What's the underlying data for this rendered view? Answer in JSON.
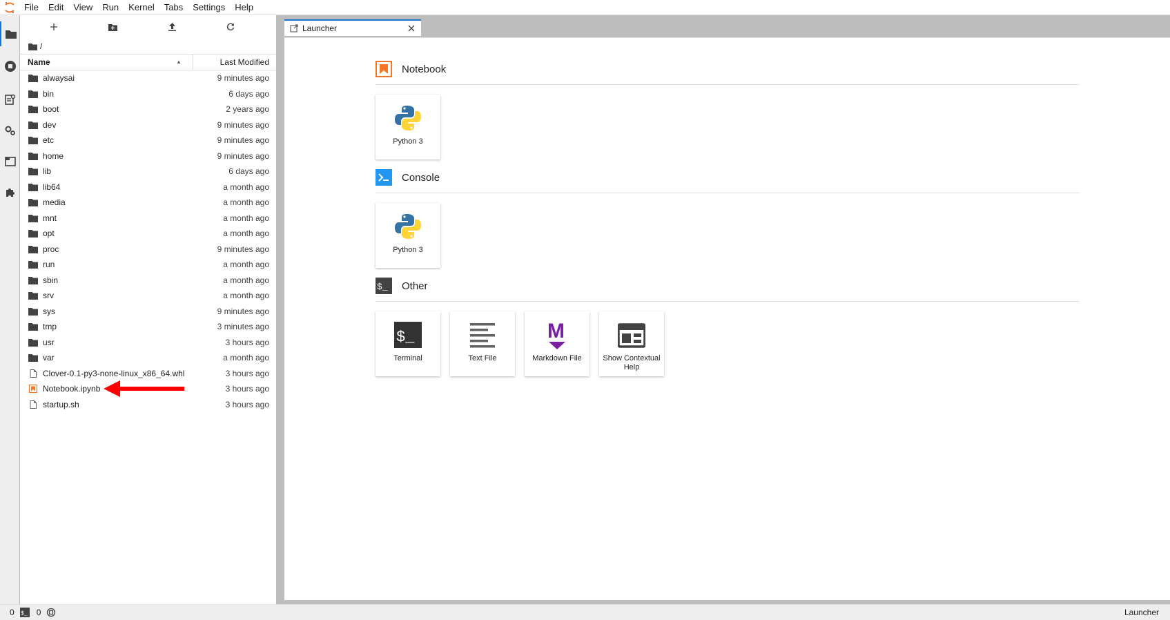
{
  "menubar": {
    "items": [
      "File",
      "Edit",
      "View",
      "Run",
      "Kernel",
      "Tabs",
      "Settings",
      "Help"
    ]
  },
  "activitybar": {
    "icons": [
      "folder-icon",
      "running-icon",
      "commands-icon",
      "property-inspector-icon",
      "tabs-icon",
      "extensions-icon"
    ]
  },
  "filebrowser": {
    "path": "/",
    "header": {
      "name": "Name",
      "modified": "Last Modified"
    },
    "files": [
      {
        "name": "alwaysai",
        "modified": "9 minutes ago",
        "type": "folder"
      },
      {
        "name": "bin",
        "modified": "6 days ago",
        "type": "folder"
      },
      {
        "name": "boot",
        "modified": "2 years ago",
        "type": "folder"
      },
      {
        "name": "dev",
        "modified": "9 minutes ago",
        "type": "folder"
      },
      {
        "name": "etc",
        "modified": "9 minutes ago",
        "type": "folder"
      },
      {
        "name": "home",
        "modified": "9 minutes ago",
        "type": "folder"
      },
      {
        "name": "lib",
        "modified": "6 days ago",
        "type": "folder"
      },
      {
        "name": "lib64",
        "modified": "a month ago",
        "type": "folder"
      },
      {
        "name": "media",
        "modified": "a month ago",
        "type": "folder"
      },
      {
        "name": "mnt",
        "modified": "a month ago",
        "type": "folder"
      },
      {
        "name": "opt",
        "modified": "a month ago",
        "type": "folder"
      },
      {
        "name": "proc",
        "modified": "9 minutes ago",
        "type": "folder"
      },
      {
        "name": "run",
        "modified": "a month ago",
        "type": "folder"
      },
      {
        "name": "sbin",
        "modified": "a month ago",
        "type": "folder"
      },
      {
        "name": "srv",
        "modified": "a month ago",
        "type": "folder"
      },
      {
        "name": "sys",
        "modified": "9 minutes ago",
        "type": "folder"
      },
      {
        "name": "tmp",
        "modified": "3 minutes ago",
        "type": "folder"
      },
      {
        "name": "usr",
        "modified": "3 hours ago",
        "type": "folder"
      },
      {
        "name": "var",
        "modified": "a month ago",
        "type": "folder"
      },
      {
        "name": "Clover-0.1-py3-none-linux_x86_64.whl",
        "modified": "3 hours ago",
        "type": "file"
      },
      {
        "name": "Notebook.ipynb",
        "modified": "3 hours ago",
        "type": "notebook"
      },
      {
        "name": "startup.sh",
        "modified": "3 hours ago",
        "type": "file"
      }
    ]
  },
  "tabs": [
    {
      "label": "Launcher"
    }
  ],
  "launcher": {
    "sections": [
      {
        "title": "Notebook",
        "cards": [
          {
            "label": "Python 3",
            "icon": "python-icon"
          }
        ]
      },
      {
        "title": "Console",
        "cards": [
          {
            "label": "Python 3",
            "icon": "python-icon"
          }
        ]
      },
      {
        "title": "Other",
        "cards": [
          {
            "label": "Terminal",
            "icon": "terminal-icon"
          },
          {
            "label": "Text File",
            "icon": "text-file-icon"
          },
          {
            "label": "Markdown File",
            "icon": "markdown-icon"
          },
          {
            "label": "Show Contextual Help",
            "icon": "contextual-help-icon"
          }
        ]
      }
    ]
  },
  "statusbar": {
    "kernels": "0",
    "terminals": "0",
    "right_label": "Launcher"
  },
  "colors": {
    "accent": "#1976d2",
    "notebook_orange": "#f37726",
    "console_blue": "#2196f3",
    "markdown_purple": "#7b1fa2",
    "annotation_red": "#ff0000"
  }
}
